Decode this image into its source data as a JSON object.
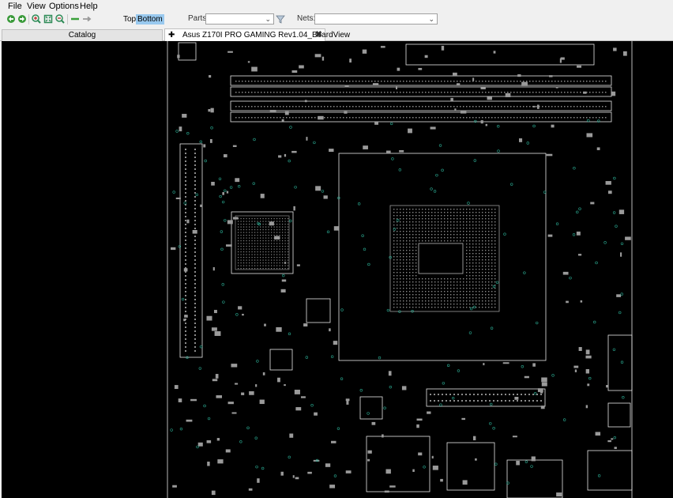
{
  "menu": {
    "file": "File",
    "view": "View",
    "options": "Options",
    "help": "Help"
  },
  "toolbar": {
    "icons": [
      "rotate-left-icon",
      "rotate-right-icon",
      "zoom-in-icon",
      "zoom-fit-icon",
      "zoom-out-icon",
      "back-arrow-icon",
      "forward-arrow-icon"
    ],
    "side_top": "Top",
    "side_bottom": "Bottom",
    "parts_label": "Parts:",
    "parts_value": "",
    "nets_label": "Nets:",
    "nets_value": ""
  },
  "tabs": {
    "catalog": "Catalog",
    "document": "Asus Z170I PRO GAMING Rev1.04_BoardView"
  },
  "colors": {
    "board_bg": "#000000",
    "outline": "#e8e8e8",
    "pin": "#8c8c8c",
    "via": "#2aa890",
    "active_side": "#99c9ef"
  }
}
